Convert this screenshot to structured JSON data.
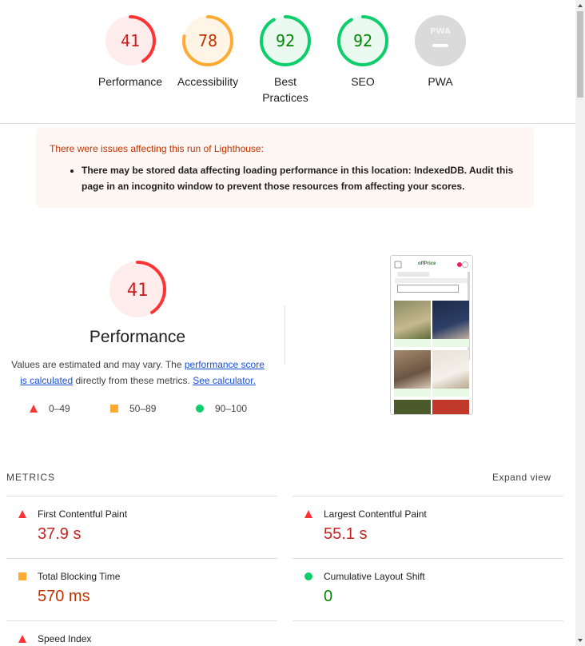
{
  "colors": {
    "fail": "#ff3333",
    "fail_text": "#c7221f",
    "average": "#ffaa33",
    "average_text": "#c33300",
    "pass": "#0cce6b",
    "pass_text": "#008800",
    "pwa_gray": "#dadada"
  },
  "gauges": [
    {
      "id": "performance",
      "score": 41,
      "score_text": "41",
      "label": "Performance",
      "rating": "fail"
    },
    {
      "id": "accessibility",
      "score": 78,
      "score_text": "78",
      "label": "Accessibility",
      "rating": "average"
    },
    {
      "id": "best-practices",
      "score": 92,
      "score_text": "92",
      "label_line1": "Best",
      "label_line2": "Practices",
      "rating": "pass"
    },
    {
      "id": "seo",
      "score": 92,
      "score_text": "92",
      "label": "SEO",
      "rating": "pass"
    },
    {
      "id": "pwa",
      "badge_text": "PWA",
      "label": "PWA",
      "icon": "pwa-badge-icon"
    }
  ],
  "warning": {
    "title": "There were issues affecting this run of Lighthouse:",
    "items": [
      "There may be stored data affecting loading performance in this location: IndexedDB. Audit this page in an incognito window to prevent those resources from affecting your scores."
    ]
  },
  "performance": {
    "score": 41,
    "score_text": "41",
    "title": "Performance",
    "desc_pre": "Values are estimated and may vary. The ",
    "desc_link1": "performance score is calculated",
    "desc_mid": " directly from these metrics. ",
    "desc_link2": "See calculator."
  },
  "legend": [
    {
      "icon": "triangle-fail-icon",
      "range": "0–49"
    },
    {
      "icon": "square-average-icon",
      "range": "50–89"
    },
    {
      "icon": "circle-pass-icon",
      "range": "90–100"
    }
  ],
  "thumbnail": {
    "logo_text": "offPrice"
  },
  "metrics": {
    "heading": "METRICS",
    "expand": "Expand view",
    "items": [
      {
        "label": "First Contentful Paint",
        "value": "37.9 s",
        "rating": "fail"
      },
      {
        "label": "Largest Contentful Paint",
        "value": "55.1 s",
        "rating": "fail"
      },
      {
        "label": "Total Blocking Time",
        "value": "570 ms",
        "rating": "average"
      },
      {
        "label": "Cumulative Layout Shift",
        "value": "0",
        "rating": "pass"
      },
      {
        "label": "Speed Index",
        "value": "",
        "rating": "fail"
      }
    ]
  }
}
